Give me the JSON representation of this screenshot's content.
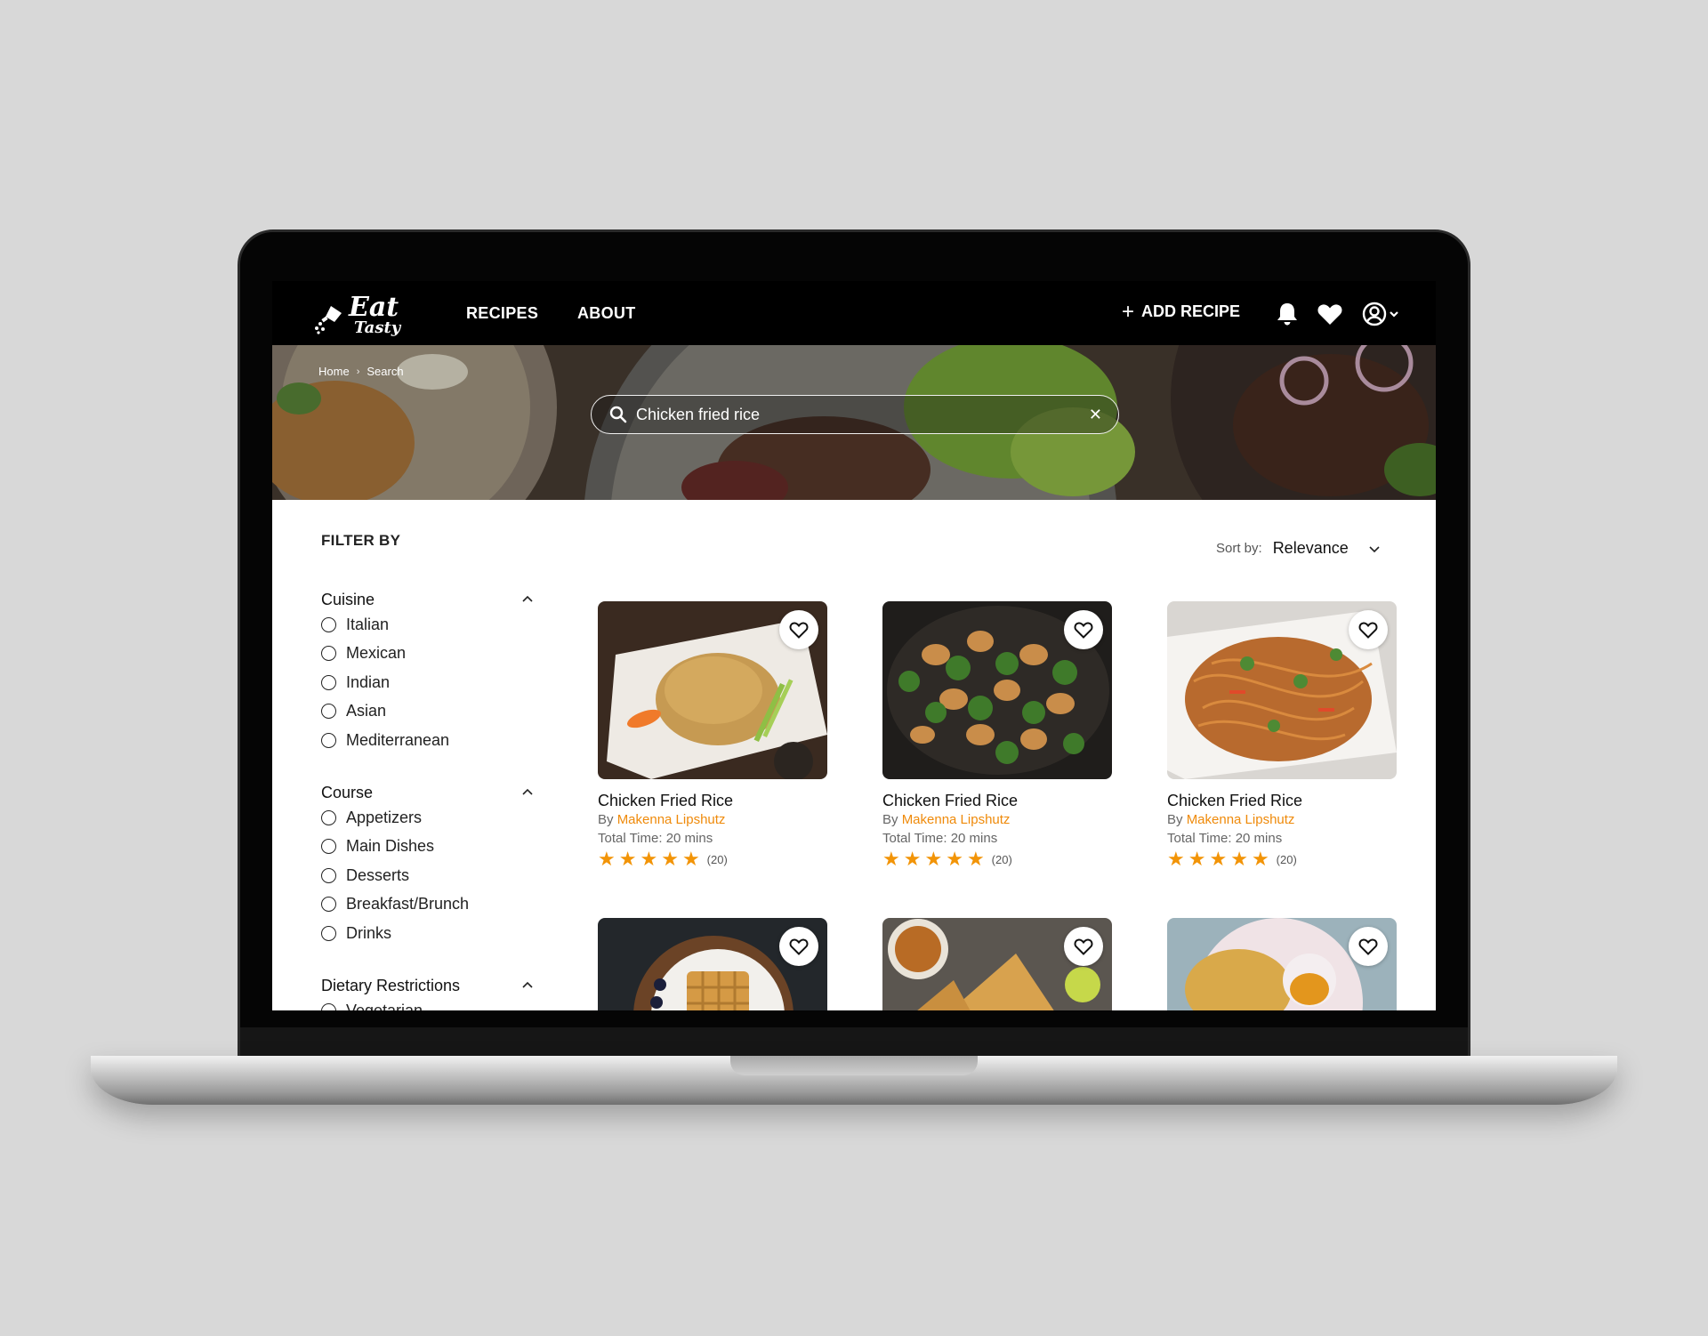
{
  "brand": {
    "line1": "Eat",
    "line2": "Tasty"
  },
  "nav": {
    "links": [
      "RECIPES",
      "ABOUT"
    ],
    "add_recipe": "ADD RECIPE",
    "icons": [
      "bell-icon",
      "heart-icon",
      "user-circle-icon",
      "chevron-down-icon"
    ]
  },
  "breadcrumb": [
    "Home",
    "Search"
  ],
  "search": {
    "value": "Chicken fried rice"
  },
  "filter": {
    "title": "FILTER BY",
    "groups": [
      {
        "label": "Cuisine",
        "options": [
          "Italian",
          "Mexican",
          "Indian",
          "Asian",
          "Mediterranean"
        ]
      },
      {
        "label": "Course",
        "options": [
          "Appetizers",
          "Main Dishes",
          "Desserts",
          "Breakfast/Brunch",
          "Drinks"
        ]
      },
      {
        "label": "Dietary Restrictions",
        "options": [
          "Vegetarian"
        ]
      }
    ]
  },
  "sort": {
    "label": "Sort by:",
    "value": "Relevance"
  },
  "cards": [
    {
      "title": "Chicken Fried Rice",
      "by": "By",
      "author": "Makenna Lipshutz",
      "time": "Total Time: 20 mins",
      "rating": 5,
      "count": "(20)",
      "image": "fried-rice-photo"
    },
    {
      "title": "Chicken Fried Rice",
      "by": "By",
      "author": "Makenna Lipshutz",
      "time": "Total Time: 20 mins",
      "rating": 5,
      "count": "(20)",
      "image": "chicken-broccoli-photo"
    },
    {
      "title": "Chicken Fried Rice",
      "by": "By",
      "author": "Makenna Lipshutz",
      "time": "Total Time: 20 mins",
      "rating": 5,
      "count": "(20)",
      "image": "noodles-photo"
    },
    {
      "image": "waffles-photo"
    },
    {
      "image": "samosa-tea-photo"
    },
    {
      "image": "puri-curry-photo"
    }
  ],
  "colors": {
    "accent": "#ef8a0a",
    "star": "#f29407",
    "nav_bg": "#000000"
  }
}
